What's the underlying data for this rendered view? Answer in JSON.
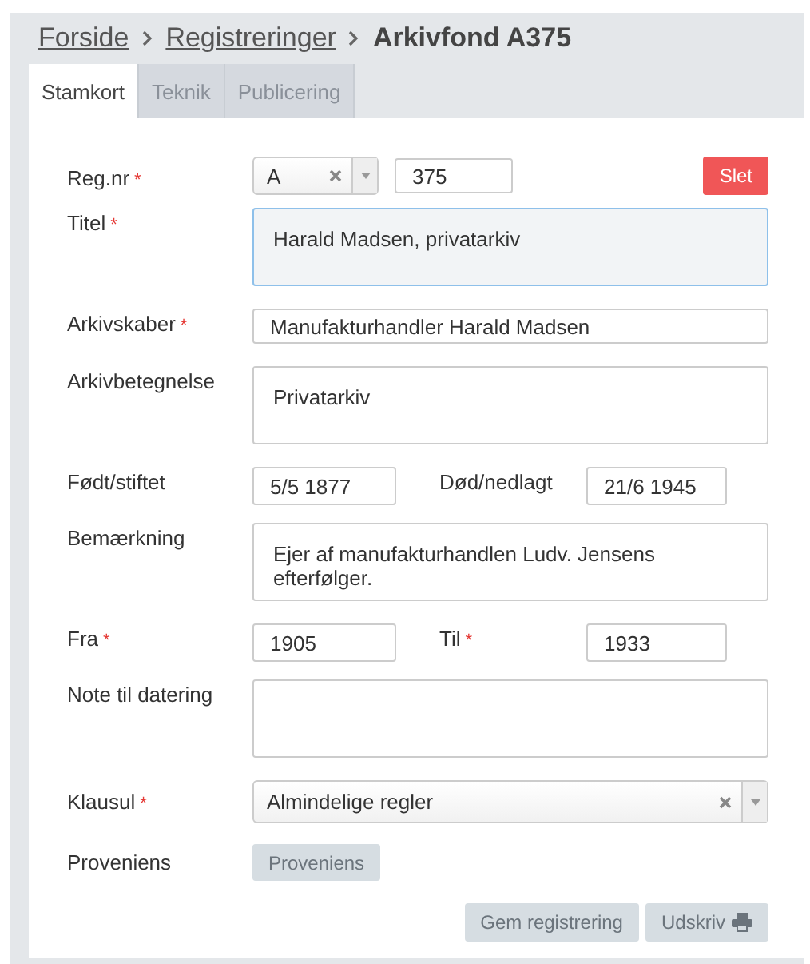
{
  "breadcrumb": [
    {
      "label": "Forside",
      "kind": "link"
    },
    {
      "label": "Registreringer",
      "kind": "link"
    },
    {
      "label": "Arkivfond A375",
      "kind": "current"
    }
  ],
  "tabs": [
    {
      "label": "Stamkort",
      "selected": true
    },
    {
      "label": "Teknik",
      "selected": false
    },
    {
      "label": "Publicering",
      "selected": false
    }
  ],
  "required_mark": "*",
  "fields": [
    {
      "kind": "regnr",
      "label": "Reg.nr",
      "required": true,
      "prefix": "A",
      "number": "375",
      "delete_button": "Slet"
    },
    {
      "kind": "textarea",
      "label": "Titel",
      "required": true,
      "value": "Harald Madsen, privatarkiv",
      "focused": true
    },
    {
      "kind": "text",
      "label": "Arkivskaber",
      "required": true,
      "value": "Manufakturhandler Harald Madsen"
    },
    {
      "kind": "textarea",
      "label": "Arkivbetegnelse",
      "required": false,
      "value": "Privatarkiv",
      "focused": false
    },
    {
      "kind": "pair",
      "label": "Født/stiftet",
      "required": false,
      "value": "5/5 1877",
      "label2": "Død/nedlagt",
      "required2": false,
      "value2": "21/6 1945"
    },
    {
      "kind": "textarea",
      "label": "Bemærkning",
      "required": false,
      "value": "Ejer af manufakturhandlen Ludv. Jensens efterfølger.",
      "focused": false
    },
    {
      "kind": "pair",
      "label": "Fra",
      "required": true,
      "value": "1905",
      "label2": "Til",
      "required2": true,
      "value2": "1933"
    },
    {
      "kind": "textarea",
      "label": "Note til datering",
      "required": false,
      "focused": false
    },
    {
      "kind": "select",
      "label": "Klausul",
      "required": true,
      "value": "Almindelige regler"
    },
    {
      "kind": "button",
      "label": "Proveniens",
      "required": false,
      "button": "Proveniens"
    }
  ],
  "actions": [
    {
      "label": "Gem registrering",
      "kind": "save"
    },
    {
      "label": "Udskriv",
      "kind": "print"
    }
  ]
}
